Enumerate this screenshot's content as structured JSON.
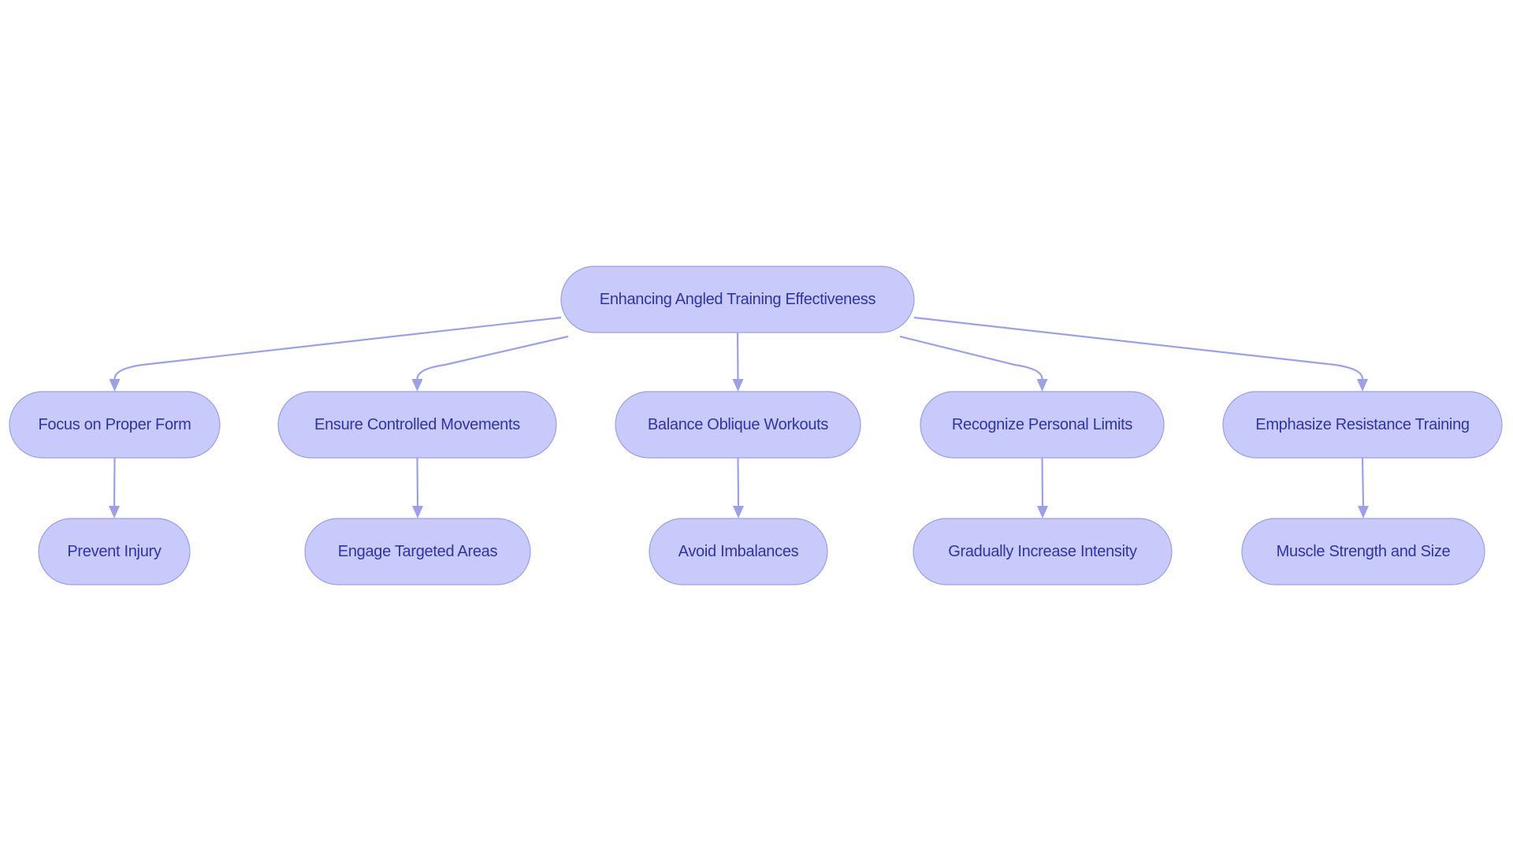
{
  "diagram": {
    "type": "flowchart-tree",
    "colors": {
      "node_fill": "#c8cafb",
      "node_stroke": "#9a9ee8",
      "edge": "#9ca0ea",
      "text": "#2f33a6",
      "background": "#ffffff"
    },
    "root": {
      "id": "root",
      "label": "Enhancing Angled Training Effectiveness"
    },
    "branches": [
      {
        "id": "b1",
        "label": "Focus on Proper Form",
        "child": {
          "id": "c1",
          "label": "Prevent Injury"
        }
      },
      {
        "id": "b2",
        "label": "Ensure Controlled Movements",
        "child": {
          "id": "c2",
          "label": "Engage Targeted Areas"
        }
      },
      {
        "id": "b3",
        "label": "Balance Oblique Workouts",
        "child": {
          "id": "c3",
          "label": "Avoid Imbalances"
        }
      },
      {
        "id": "b4",
        "label": "Recognize Personal Limits",
        "child": {
          "id": "c4",
          "label": "Gradually Increase Intensity"
        }
      },
      {
        "id": "b5",
        "label": "Emphasize Resistance Training",
        "child": {
          "id": "c5",
          "label": "Muscle Strength and Size"
        }
      }
    ],
    "edges": [
      {
        "from": "root",
        "to": "b1"
      },
      {
        "from": "root",
        "to": "b2"
      },
      {
        "from": "root",
        "to": "b3"
      },
      {
        "from": "root",
        "to": "b4"
      },
      {
        "from": "root",
        "to": "b5"
      },
      {
        "from": "b1",
        "to": "c1"
      },
      {
        "from": "b2",
        "to": "c2"
      },
      {
        "from": "b3",
        "to": "c3"
      },
      {
        "from": "b4",
        "to": "c4"
      },
      {
        "from": "b5",
        "to": "c5"
      }
    ]
  }
}
